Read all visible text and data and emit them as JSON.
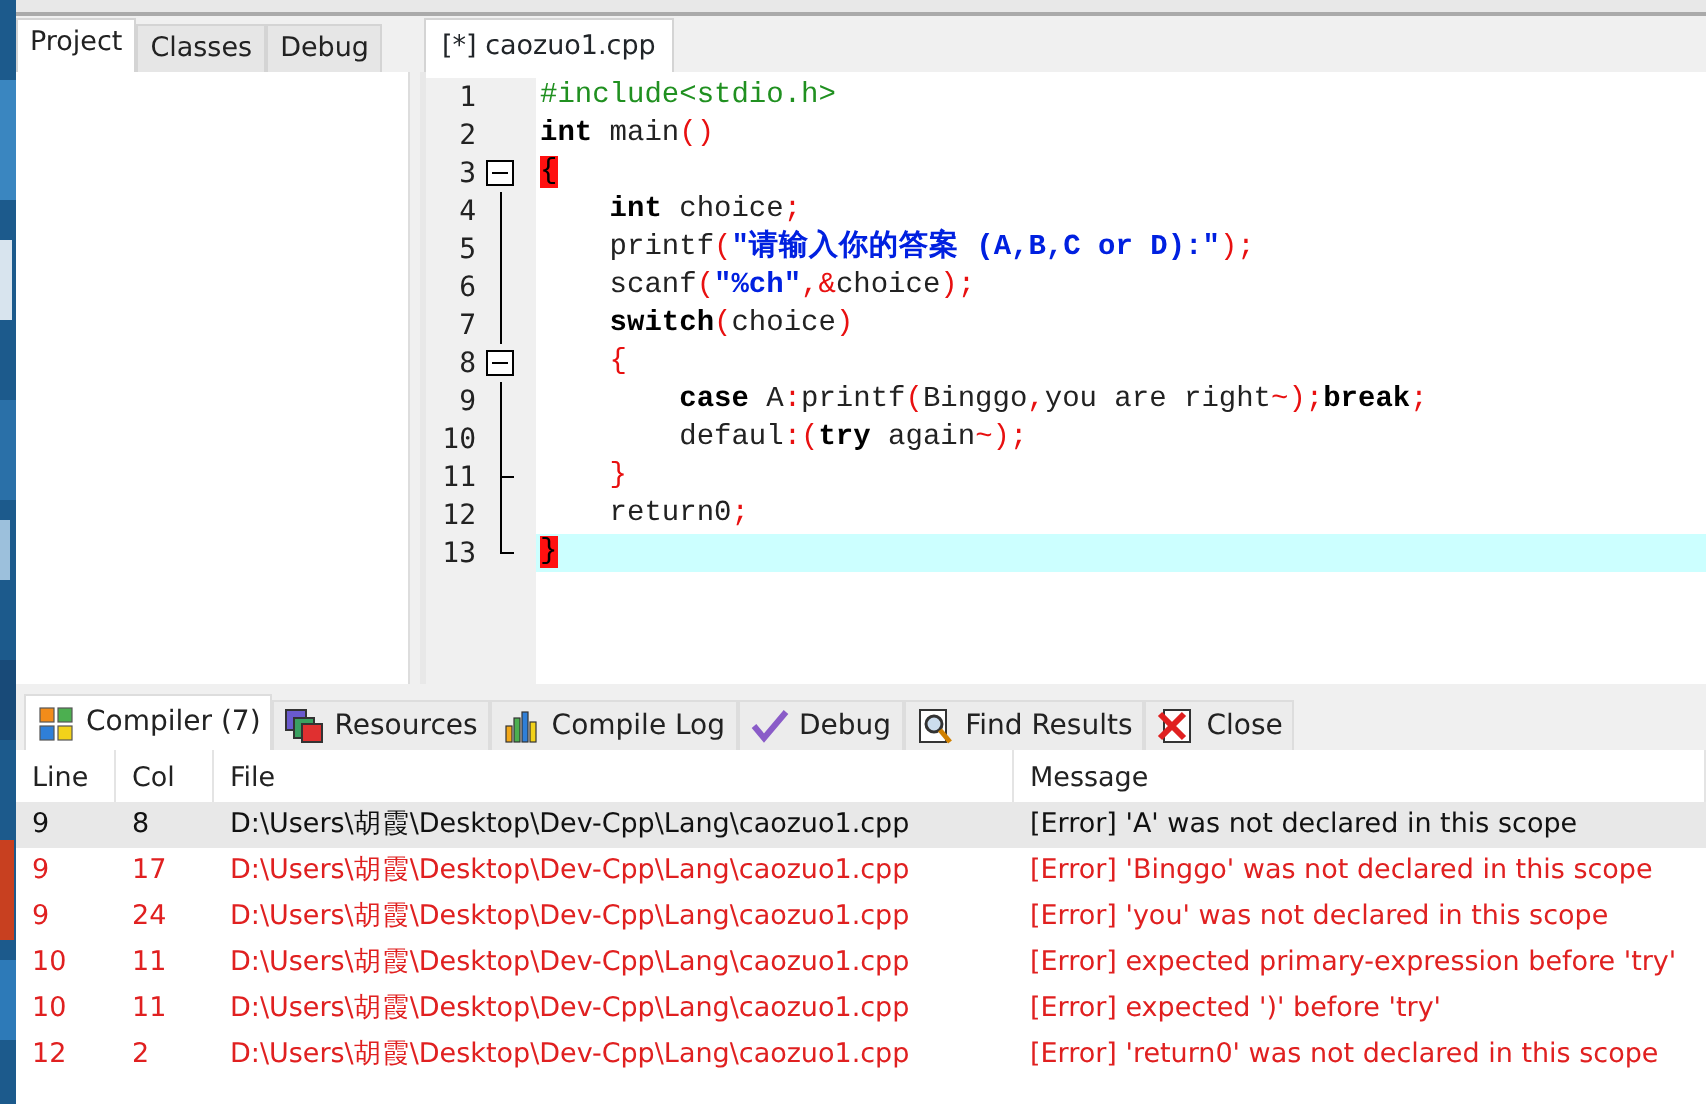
{
  "project_tabs": [
    {
      "label": "Project",
      "selected": true
    },
    {
      "label": "Classes",
      "selected": false
    },
    {
      "label": "Debug",
      "selected": false
    }
  ],
  "editor_tabs": [
    {
      "label": "[*] caozuo1.cpp",
      "selected": true
    }
  ],
  "code_lines": [
    {
      "number": "1",
      "tokens": [
        {
          "kind": "pre",
          "text": "#include<stdio.h>"
        }
      ]
    },
    {
      "number": "2",
      "tokens": [
        {
          "kind": "kw",
          "text": "int"
        },
        {
          "kind": "plain",
          "text": " main"
        },
        {
          "kind": "sym",
          "text": "()"
        }
      ]
    },
    {
      "number": "3",
      "expanded": true,
      "tokens": [
        {
          "kind": "match",
          "text": "{"
        }
      ]
    },
    {
      "number": "4",
      "tokens": [
        {
          "kind": "kw",
          "text": "    int"
        },
        {
          "kind": "plain",
          "text": " choice"
        },
        {
          "kind": "sym",
          "text": ";"
        }
      ]
    },
    {
      "number": "5",
      "tokens": [
        {
          "kind": "plain",
          "text": "    printf"
        },
        {
          "kind": "sym",
          "text": "("
        },
        {
          "kind": "str",
          "text": "\"请输入你的答案 (A,B,C or D):\""
        },
        {
          "kind": "sym",
          "text": ");"
        }
      ]
    },
    {
      "number": "6",
      "tokens": [
        {
          "kind": "plain",
          "text": "    scanf"
        },
        {
          "kind": "sym",
          "text": "("
        },
        {
          "kind": "str",
          "text": "\"%ch\""
        },
        {
          "kind": "sym",
          "text": ",&"
        },
        {
          "kind": "plain",
          "text": "choice"
        },
        {
          "kind": "sym",
          "text": ");"
        }
      ]
    },
    {
      "number": "7",
      "tokens": [
        {
          "kind": "kw",
          "text": "    switch"
        },
        {
          "kind": "sym",
          "text": "("
        },
        {
          "kind": "plain",
          "text": "choice"
        },
        {
          "kind": "sym",
          "text": ")"
        }
      ]
    },
    {
      "number": "8",
      "expanded": true,
      "tokens": [
        {
          "kind": "sym",
          "text": "    {"
        }
      ]
    },
    {
      "number": "9",
      "tokens": [
        {
          "kind": "kw",
          "text": "        case"
        },
        {
          "kind": "plain",
          "text": " A"
        },
        {
          "kind": "sym",
          "text": ":"
        },
        {
          "kind": "plain",
          "text": "printf"
        },
        {
          "kind": "sym",
          "text": "("
        },
        {
          "kind": "plain",
          "text": "Binggo"
        },
        {
          "kind": "sym",
          "text": ","
        },
        {
          "kind": "plain",
          "text": "you are right"
        },
        {
          "kind": "sym",
          "text": "~);"
        },
        {
          "kind": "kw",
          "text": "break"
        },
        {
          "kind": "sym",
          "text": ";"
        }
      ]
    },
    {
      "number": "10",
      "tokens": [
        {
          "kind": "plain",
          "text": "        defaul"
        },
        {
          "kind": "sym",
          "text": ":("
        },
        {
          "kind": "kw",
          "text": "try"
        },
        {
          "kind": "plain",
          "text": " again"
        },
        {
          "kind": "sym",
          "text": "~);"
        }
      ]
    },
    {
      "number": "11",
      "fold_end": true,
      "tokens": [
        {
          "kind": "sym",
          "text": "    }"
        }
      ]
    },
    {
      "number": "12",
      "tokens": [
        {
          "kind": "plain",
          "text": "    return0"
        },
        {
          "kind": "sym",
          "text": ";"
        }
      ]
    },
    {
      "number": "13",
      "fold_end": true,
      "current": true,
      "tokens": [
        {
          "kind": "match",
          "text": "}"
        }
      ]
    }
  ],
  "bottom_tabs": [
    {
      "label": "Compiler (7)",
      "selected": true
    },
    {
      "label": "Resources",
      "selected": false
    },
    {
      "label": "Compile Log",
      "selected": false
    },
    {
      "label": "Debug",
      "selected": false
    },
    {
      "label": "Find Results",
      "selected": false
    },
    {
      "label": "Close",
      "selected": false
    }
  ],
  "table": {
    "columns": [
      "Line",
      "Col",
      "File",
      "Message"
    ],
    "rows": [
      {
        "selected": true,
        "cells": [
          "9",
          "8",
          "D:\\Users\\胡霞\\Desktop\\Dev-Cpp\\Lang\\caozuo1.cpp",
          "[Error] 'A' was not declared in this scope"
        ]
      },
      {
        "selected": false,
        "cells": [
          "9",
          "17",
          "D:\\Users\\胡霞\\Desktop\\Dev-Cpp\\Lang\\caozuo1.cpp",
          "[Error] 'Binggo' was not declared in this scope"
        ]
      },
      {
        "selected": false,
        "cells": [
          "9",
          "24",
          "D:\\Users\\胡霞\\Desktop\\Dev-Cpp\\Lang\\caozuo1.cpp",
          "[Error] 'you' was not declared in this scope"
        ]
      },
      {
        "selected": false,
        "cells": [
          "10",
          "11",
          "D:\\Users\\胡霞\\Desktop\\Dev-Cpp\\Lang\\caozuo1.cpp",
          "[Error] expected primary-expression before 'try'"
        ]
      },
      {
        "selected": false,
        "cells": [
          "10",
          "11",
          "D:\\Users\\胡霞\\Desktop\\Dev-Cpp\\Lang\\caozuo1.cpp",
          "[Error] expected ')' before 'try'"
        ]
      },
      {
        "selected": false,
        "cells": [
          "12",
          "2",
          "D:\\Users\\胡霞\\Desktop\\Dev-Cpp\\Lang\\caozuo1.cpp",
          "[Error] 'return0' was not declared in this scope"
        ]
      }
    ]
  }
}
